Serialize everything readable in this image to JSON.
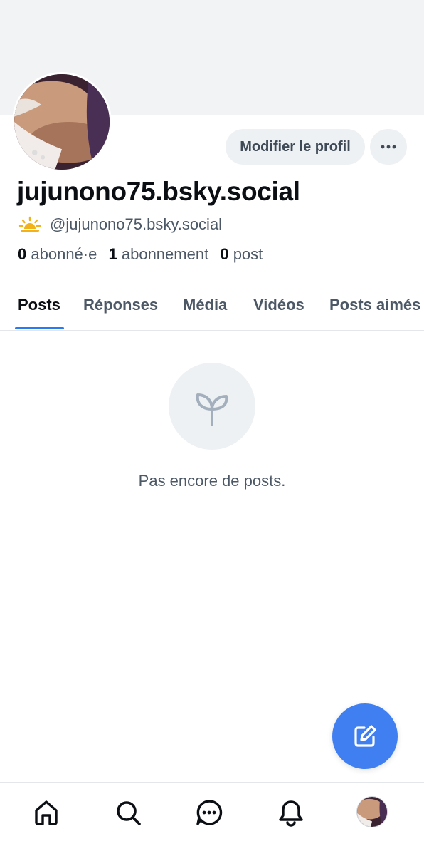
{
  "profile": {
    "display_name": "jujunono75.bsky.social",
    "handle": "@jujunono75.bsky.social",
    "edit_button_label": "Modifier le profil",
    "more_icon": "more-horizontal-icon",
    "status_icon": "sun-horizon-icon"
  },
  "stats": {
    "followers_count": "0",
    "followers_label": "abonné·e",
    "following_count": "1",
    "following_label": "abonnement",
    "posts_count": "0",
    "posts_label": "post"
  },
  "tabs": [
    {
      "label": "Posts",
      "active": true
    },
    {
      "label": "Réponses",
      "active": false
    },
    {
      "label": "Média",
      "active": false
    },
    {
      "label": "Vidéos",
      "active": false
    },
    {
      "label": "Posts aimés",
      "active": false
    }
  ],
  "empty_state": {
    "icon": "sprout-icon",
    "message": "Pas encore de posts."
  },
  "fab": {
    "icon": "compose-icon"
  },
  "bottom_nav": [
    {
      "name": "home",
      "icon": "home-icon"
    },
    {
      "name": "search",
      "icon": "search-icon"
    },
    {
      "name": "chat",
      "icon": "chat-icon"
    },
    {
      "name": "notifications",
      "icon": "bell-icon"
    },
    {
      "name": "profile",
      "icon": "avatar"
    }
  ],
  "colors": {
    "accent": "#2b7bf0",
    "fab": "#3f7ff2",
    "muted_text": "#4d5866",
    "banner": "#f1f3f5"
  }
}
